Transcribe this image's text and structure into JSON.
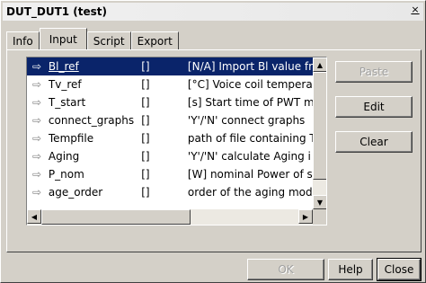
{
  "window": {
    "title": "DUT_DUT1 (test)",
    "close_glyph": "×"
  },
  "tabs": [
    {
      "label": "Info",
      "active": false
    },
    {
      "label": "Input",
      "active": true
    },
    {
      "label": "Script",
      "active": false
    },
    {
      "label": "Export",
      "active": false
    }
  ],
  "list": {
    "rows": [
      {
        "arrow": "⇨",
        "name": "Bl_ref",
        "unit": "[]",
        "desc": "[N/A] Import Bl value fr",
        "selected": true
      },
      {
        "arrow": "⇨",
        "name": "Tv_ref",
        "unit": "[]",
        "desc": "[°C] Voice coil temperat",
        "selected": false
      },
      {
        "arrow": "⇨",
        "name": "T_start",
        "unit": "[]",
        "desc": "[s] Start time of PWT m",
        "selected": false
      },
      {
        "arrow": "⇨",
        "name": "connect_graphs",
        "unit": "[]",
        "desc": "'Y'/'N' connect graphs",
        "selected": false
      },
      {
        "arrow": "⇨",
        "name": "Tempfile",
        "unit": "[]",
        "desc": "path of file containing T",
        "selected": false
      },
      {
        "arrow": "⇨",
        "name": "Aging",
        "unit": "[]",
        "desc": "'Y'/'N' calculate Aging i",
        "selected": false
      },
      {
        "arrow": "⇨",
        "name": "P_nom",
        "unit": "[]",
        "desc": "[W] nominal Power of s",
        "selected": false
      },
      {
        "arrow": "⇨",
        "name": "age_order",
        "unit": "[]",
        "desc": "order of the aging mode",
        "selected": false
      }
    ]
  },
  "side_buttons": {
    "paste": "Paste",
    "edit": "Edit",
    "clear": "Clear"
  },
  "footer_buttons": {
    "ok": "OK",
    "help": "Help",
    "close": "Close"
  }
}
